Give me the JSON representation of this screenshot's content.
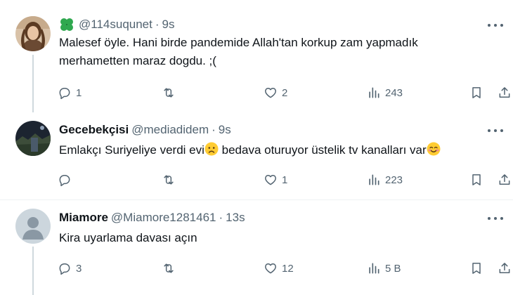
{
  "tweets": [
    {
      "name": "",
      "handle": "@114suqunet",
      "time": "9s",
      "text_line1": "Malesef öyle. Hani birde pandemide Allah'tan korkup zam yapmadık",
      "text_line2": "merhametten maraz dogdu. ;(",
      "replies": "1",
      "reposts": "",
      "likes": "2",
      "views": "243",
      "name_icon": "clover-icon"
    },
    {
      "name": "Gecebekçisi",
      "handle": "@mediadidem",
      "time": "9s",
      "text_part1": "Emlakçı Suriyeliye verdi evi",
      "text_part2": " bedava oturuyor üstelik tv kanalları var",
      "emoji1": "worried-face-emoji",
      "emoji2": "smiling-face-emoji",
      "replies": "",
      "reposts": "",
      "likes": "1",
      "views": "223"
    },
    {
      "name": "Miamore",
      "handle": "@Miamore1281461",
      "time": "13s",
      "text": "Kira uyarlama davası açın",
      "replies": "3",
      "reposts": "",
      "likes": "12",
      "views": "5 B"
    }
  ],
  "separator": "·",
  "colors": {
    "text": "#0f1419",
    "muted": "#536471",
    "thread_line": "#cfd9de",
    "clover": "#2fa84f"
  }
}
